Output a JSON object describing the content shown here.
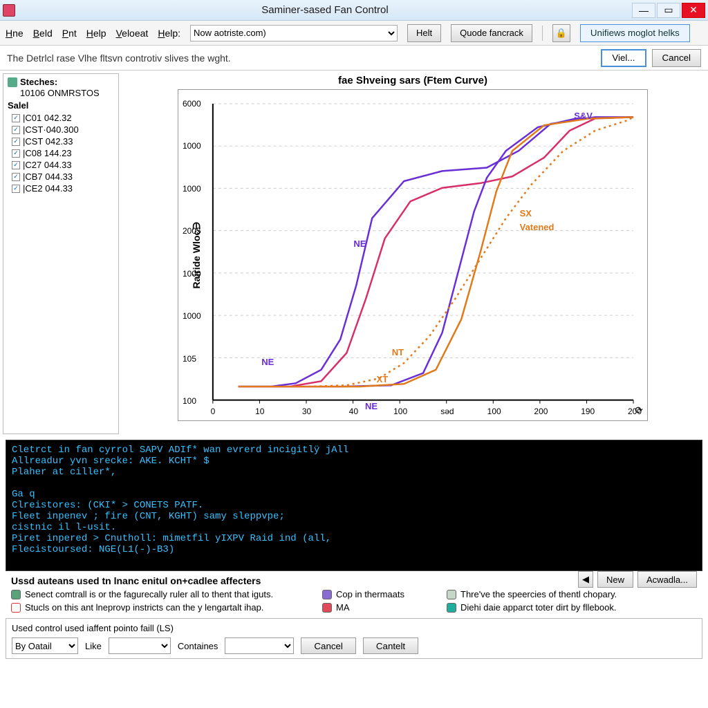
{
  "window": {
    "title": "Saminer-sased Fan Control"
  },
  "menu": {
    "items": [
      "Hne",
      "Beld",
      "Pnt",
      "Help",
      "Veloeat",
      "Help:"
    ],
    "addr": "Now aotriste.com)",
    "btn1": "Helt",
    "btn2": "Quode fancrack",
    "btn3": "Unifiews moglot helks"
  },
  "subheader": {
    "text": "The  Detrlcl rase  Vlhe fltsvn controtiv slives the wght.",
    "btn_viel": "Viel...",
    "btn_cancel": "Cancel"
  },
  "sidebar": {
    "header": "Steches:",
    "node": "10106 ONMRSTOS",
    "group": "Salel",
    "items": [
      {
        "label": "|C01 042.32",
        "checked": true
      },
      {
        "label": "|CST·040.300",
        "checked": true
      },
      {
        "label": "|CST 042.33",
        "checked": true
      },
      {
        "label": "|C08 144.23",
        "checked": true
      },
      {
        "label": "|C27 044.33",
        "checked": true
      },
      {
        "label": "|CB7 044.33",
        "checked": true
      },
      {
        "label": "|CE2 044.33",
        "checked": true
      }
    ]
  },
  "chart_data": {
    "type": "line",
    "title": "fae Shveing sars (Ftem Curve)",
    "ylabel": "Rairide Wloc∋",
    "y_ticks": [
      "6000",
      "1000",
      "1000",
      "2005",
      "1000",
      "1000",
      "105",
      "100"
    ],
    "x_ticks": [
      "0",
      "10",
      "30",
      "40",
      "100",
      "səd",
      "100",
      "200",
      "190",
      "200"
    ],
    "xlim": [
      0,
      660
    ],
    "ylim": [
      0,
      440
    ],
    "annotations": [
      {
        "text": "S&V",
        "x": 565,
        "y": 10,
        "color": "#6a2ed6"
      },
      {
        "text": "SX",
        "x": 480,
        "y": 155,
        "color": "#e07a1a"
      },
      {
        "text": "Vatened",
        "x": 480,
        "y": 175,
        "color": "#e07a1a"
      },
      {
        "text": "NE",
        "x": 220,
        "y": 200,
        "color": "#6a2ed6"
      },
      {
        "text": "NT",
        "x": 280,
        "y": 360,
        "color": "#e07a1a"
      },
      {
        "text": "XT",
        "x": 256,
        "y": 400,
        "color": "#e07a1a"
      },
      {
        "text": "NE",
        "x": 76,
        "y": 374,
        "color": "#6a2ed6"
      },
      {
        "text": "NE",
        "x": 238,
        "y": 440,
        "color": "#6a2ed6"
      }
    ],
    "series": [
      {
        "name": "purple-left",
        "color": "#6a2ed6",
        "dash": false,
        "points": [
          [
            40,
            420
          ],
          [
            90,
            420
          ],
          [
            130,
            415
          ],
          [
            170,
            395
          ],
          [
            200,
            350
          ],
          [
            225,
            270
          ],
          [
            250,
            170
          ],
          [
            300,
            115
          ],
          [
            360,
            100
          ],
          [
            430,
            95
          ],
          [
            480,
            70
          ],
          [
            530,
            30
          ],
          [
            600,
            20
          ],
          [
            660,
            20
          ]
        ]
      },
      {
        "name": "magenta",
        "color": "#d82e6a",
        "dash": false,
        "points": [
          [
            40,
            420
          ],
          [
            120,
            420
          ],
          [
            170,
            412
          ],
          [
            210,
            370
          ],
          [
            240,
            290
          ],
          [
            270,
            200
          ],
          [
            310,
            145
          ],
          [
            360,
            125
          ],
          [
            420,
            118
          ],
          [
            470,
            108
          ],
          [
            520,
            80
          ],
          [
            560,
            40
          ],
          [
            600,
            22
          ],
          [
            660,
            20
          ]
        ]
      },
      {
        "name": "purple-right",
        "color": "#6a2ed6",
        "dash": false,
        "points": [
          [
            40,
            420
          ],
          [
            200,
            420
          ],
          [
            280,
            418
          ],
          [
            330,
            400
          ],
          [
            360,
            340
          ],
          [
            385,
            250
          ],
          [
            410,
            160
          ],
          [
            430,
            110
          ],
          [
            460,
            70
          ],
          [
            510,
            35
          ],
          [
            570,
            22
          ],
          [
            660,
            20
          ]
        ]
      },
      {
        "name": "orange-solid",
        "color": "#e07a1a",
        "dash": false,
        "points": [
          [
            40,
            420
          ],
          [
            230,
            420
          ],
          [
            300,
            416
          ],
          [
            350,
            395
          ],
          [
            390,
            320
          ],
          [
            420,
            220
          ],
          [
            445,
            130
          ],
          [
            470,
            70
          ],
          [
            520,
            32
          ],
          [
            590,
            22
          ],
          [
            660,
            20
          ]
        ]
      },
      {
        "name": "orange-dotted",
        "color": "#e07a1a",
        "dash": true,
        "points": [
          [
            150,
            420
          ],
          [
            210,
            418
          ],
          [
            260,
            408
          ],
          [
            300,
            385
          ],
          [
            340,
            345
          ],
          [
            380,
            290
          ],
          [
            420,
            230
          ],
          [
            460,
            170
          ],
          [
            500,
            120
          ],
          [
            550,
            70
          ],
          [
            600,
            40
          ],
          [
            650,
            25
          ],
          [
            660,
            20
          ]
        ]
      }
    ]
  },
  "console_lines": [
    "Cletrct in fan cyrrol SAPV ADIf* wan evrerd incigitlÿ jAll",
    "Allreadur yvn srecke: AKE. KCHT* $",
    "Plaher at ciller*,",
    "",
    "Ga q",
    "Clreistores: (CKI* > CONETS PATF.",
    "Fleet inpenev ; fire (CNT, KGHT) samy sleppvpe;",
    "cistnic il l-usit.",
    "Piret inpered > Cnutholl: mimetfil yIXPV Raid ind (all,",
    "Flecistoursed: NGE(L1(-)-B3)"
  ],
  "legend": {
    "title": "Ussd auteans used tn lnanc enitul on+cadlee affecters",
    "items": [
      {
        "swatch": "#5aa27a",
        "text": "Senect comtrall is or the fagurecally ruler all to thent that iguts."
      },
      {
        "swatch": "#ffffff",
        "border": "#d33",
        "text": "Stucls on this ant lneprovp instricts can the y lengartalt ihap."
      },
      {
        "swatch": "#8a6bd6",
        "text": "Cop in thermaats"
      },
      {
        "swatch": "#e04a56",
        "text": "MA"
      },
      {
        "swatch": "#c4d7c8",
        "text": "Thre've the speercies of thentl chopary."
      },
      {
        "swatch": "#1fae9e",
        "text": "Diehi daie apparct toter dirt by fllebook."
      }
    ],
    "btn_new": "New",
    "btn_ac": "Acwadla..."
  },
  "filter": {
    "title": "Used control used iaffent pointo faill (LS)",
    "sel1": "By Oatail",
    "lbl_like": "Like",
    "lbl_cont": "Containes",
    "btn_cancel": "Cancel",
    "btn_cantet": "Cantelt"
  }
}
